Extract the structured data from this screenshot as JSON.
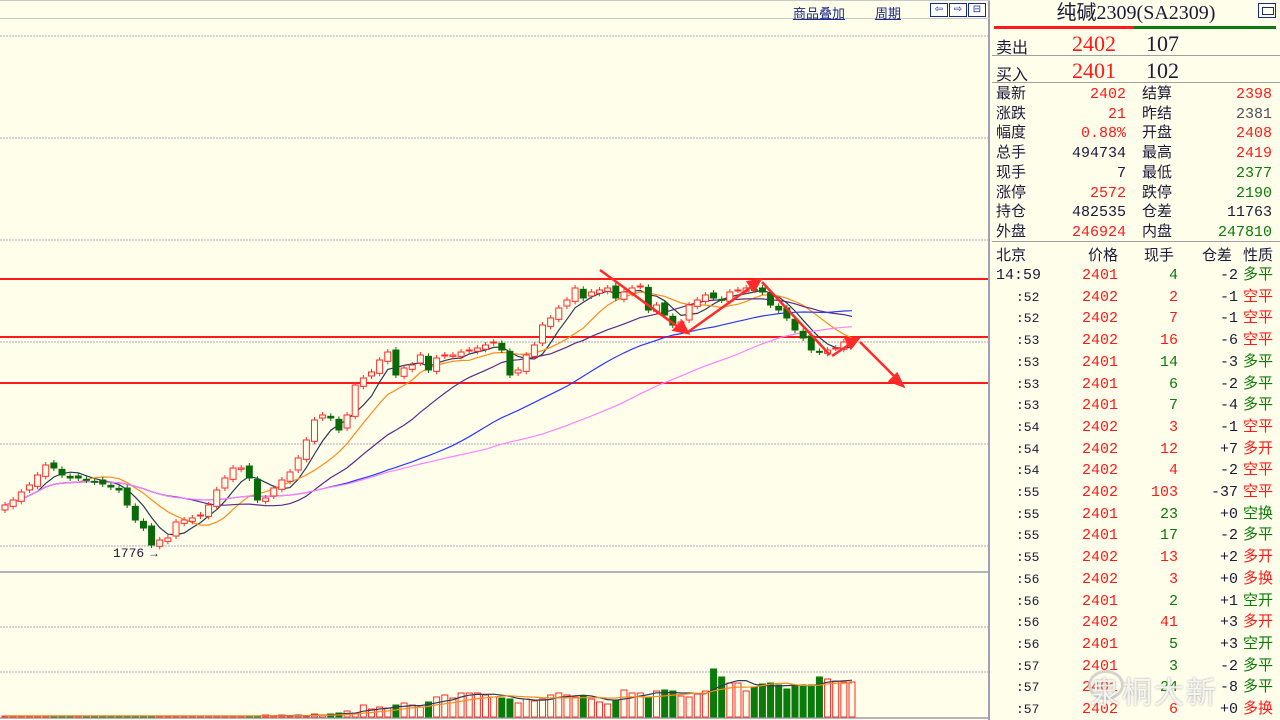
{
  "toolbar": {
    "overlay_label": "商品叠加",
    "period_label": "周期",
    "nav_left": "⇦",
    "nav_right": "⇨",
    "nav_layout": "⊟"
  },
  "quote": {
    "title": "纯碱2309(SA2309)",
    "ask": {
      "label": "卖出",
      "price": "2402",
      "volume": "107"
    },
    "bid": {
      "label": "买入",
      "price": "2401",
      "volume": "102"
    },
    "stats_left": [
      {
        "label": "最新",
        "value": "2402",
        "color": "red"
      },
      {
        "label": "涨跌",
        "value": "21",
        "color": "red"
      },
      {
        "label": "幅度",
        "value": "0.88%",
        "color": "red"
      },
      {
        "label": "总手",
        "value": "494734",
        "color": "dark"
      },
      {
        "label": "现手",
        "value": "7",
        "color": "dark"
      },
      {
        "label": "涨停",
        "value": "2572",
        "color": "red"
      },
      {
        "label": "持仓",
        "value": "482535",
        "color": "dark"
      },
      {
        "label": "外盘",
        "value": "246924",
        "color": "red"
      }
    ],
    "stats_right": [
      {
        "label": "结算",
        "value": "2398",
        "color": "red"
      },
      {
        "label": "昨结",
        "value": "2381",
        "color": "gray"
      },
      {
        "label": "开盘",
        "value": "2408",
        "color": "red"
      },
      {
        "label": "最高",
        "value": "2419",
        "color": "red"
      },
      {
        "label": "最低",
        "value": "2377",
        "color": "green"
      },
      {
        "label": "跌停",
        "value": "2190",
        "color": "green"
      },
      {
        "label": "仓差",
        "value": "11763",
        "color": "dark"
      },
      {
        "label": "内盘",
        "value": "247810",
        "color": "green"
      }
    ]
  },
  "ticks": {
    "headers": [
      "北京",
      "价格",
      "现手",
      "仓差",
      "性质"
    ],
    "rows": [
      {
        "time": "14:59",
        "price": "2401",
        "vol": "4",
        "oi": "-2",
        "type": "多平",
        "side": "green"
      },
      {
        "time": ":52",
        "price": "2402",
        "vol": "2",
        "oi": "-1",
        "type": "空平",
        "side": "red"
      },
      {
        "time": ":52",
        "price": "2402",
        "vol": "7",
        "oi": "-1",
        "type": "空平",
        "side": "red"
      },
      {
        "time": ":53",
        "price": "2402",
        "vol": "16",
        "oi": "-6",
        "type": "空平",
        "side": "red"
      },
      {
        "time": ":53",
        "price": "2401",
        "vol": "14",
        "oi": "-3",
        "type": "多平",
        "side": "green"
      },
      {
        "time": ":53",
        "price": "2401",
        "vol": "6",
        "oi": "-2",
        "type": "多平",
        "side": "green"
      },
      {
        "time": ":53",
        "price": "2401",
        "vol": "7",
        "oi": "-4",
        "type": "多平",
        "side": "green"
      },
      {
        "time": ":54",
        "price": "2402",
        "vol": "3",
        "oi": "-1",
        "type": "空平",
        "side": "red"
      },
      {
        "time": ":54",
        "price": "2402",
        "vol": "12",
        "oi": "+7",
        "type": "多开",
        "side": "red"
      },
      {
        "time": ":54",
        "price": "2402",
        "vol": "4",
        "oi": "-2",
        "type": "空平",
        "side": "red"
      },
      {
        "time": ":55",
        "price": "2402",
        "vol": "103",
        "oi": "-37",
        "type": "空平",
        "side": "red"
      },
      {
        "time": ":55",
        "price": "2401",
        "vol": "23",
        "oi": "+0",
        "type": "空换",
        "side": "green"
      },
      {
        "time": ":55",
        "price": "2401",
        "vol": "17",
        "oi": "-2",
        "type": "多平",
        "side": "green"
      },
      {
        "time": ":55",
        "price": "2402",
        "vol": "13",
        "oi": "+2",
        "type": "多开",
        "side": "red"
      },
      {
        "time": ":56",
        "price": "2402",
        "vol": "3",
        "oi": "+0",
        "type": "多换",
        "side": "red"
      },
      {
        "time": ":56",
        "price": "2401",
        "vol": "2",
        "oi": "+1",
        "type": "空开",
        "side": "green"
      },
      {
        "time": ":56",
        "price": "2402",
        "vol": "41",
        "oi": "+3",
        "type": "多开",
        "side": "red"
      },
      {
        "time": ":56",
        "price": "2401",
        "vol": "5",
        "oi": "+3",
        "type": "空开",
        "side": "green"
      },
      {
        "time": ":57",
        "price": "2401",
        "vol": "3",
        "oi": "-2",
        "type": "多平",
        "side": "green"
      },
      {
        "time": ":57",
        "price": "2401",
        "vol": "24",
        "oi": "-8",
        "type": "多平",
        "side": "green"
      },
      {
        "time": ":57",
        "price": "2402",
        "vol": "6",
        "oi": "+0",
        "type": "多换",
        "side": "red"
      }
    ]
  },
  "watermark": "泉桐大新",
  "chart_data": {
    "type": "candlestick",
    "title": "纯碱2309(SA2309)",
    "low_label": "1776",
    "ylim": [
      1770,
      2650
    ],
    "levels": [
      2598,
      2424,
      2286
    ],
    "closes": [
      1920,
      1935,
      1959,
      1980,
      2010,
      2040,
      2031,
      2010,
      2001,
      2001,
      1995,
      1989,
      1983,
      1974,
      1965,
      1920,
      1875,
      1851,
      1800,
      1815,
      1821,
      1869,
      1875,
      1881,
      1890,
      1920,
      1965,
      2001,
      2031,
      2031,
      2001,
      1935,
      1941,
      1971,
      1995,
      2019,
      2061,
      2115,
      2175,
      2190,
      2181,
      2145,
      2190,
      2280,
      2301,
      2319,
      2355,
      2379,
      2310,
      2331,
      2340,
      2370,
      2325,
      2361,
      2370,
      2370,
      2379,
      2385,
      2391,
      2400,
      2409,
      2385,
      2310,
      2325,
      2370,
      2400,
      2460,
      2481,
      2511,
      2535,
      2571,
      2541,
      2559,
      2565,
      2571,
      2541,
      2559,
      2571,
      2577,
      2505,
      2520,
      2490,
      2460,
      2469,
      2520,
      2535,
      2550,
      2541,
      2535,
      2559,
      2565,
      2571,
      2565,
      2559,
      2520,
      2505,
      2481,
      2445,
      2421,
      2385,
      2379,
      2385,
      2391,
      2409,
      2409
    ],
    "volumes": [
      1,
      1,
      1,
      1,
      1,
      1,
      1,
      1,
      1,
      1,
      1,
      1,
      1,
      1,
      1,
      1,
      1,
      1,
      1,
      1,
      1,
      1,
      1,
      1,
      1,
      1,
      1,
      1,
      1,
      1,
      1,
      1,
      1,
      1,
      1,
      1,
      1,
      1,
      1,
      1,
      1,
      1,
      1,
      1,
      1,
      2,
      1,
      2,
      1,
      2,
      1,
      3,
      2,
      3,
      4,
      6,
      4,
      12,
      8,
      10,
      9,
      12,
      14,
      12,
      10,
      15,
      20,
      22,
      19,
      24,
      24,
      24,
      22,
      20,
      19,
      18,
      14,
      18,
      16,
      18,
      22,
      24,
      22,
      20,
      21,
      18,
      15,
      13,
      17,
      27,
      24,
      24,
      20,
      26,
      27,
      26,
      21,
      20,
      23,
      26,
      48,
      40,
      34,
      34,
      26,
      30,
      33,
      34,
      32,
      28,
      32,
      32,
      32,
      40,
      38,
      36,
      35,
      35
    ]
  }
}
